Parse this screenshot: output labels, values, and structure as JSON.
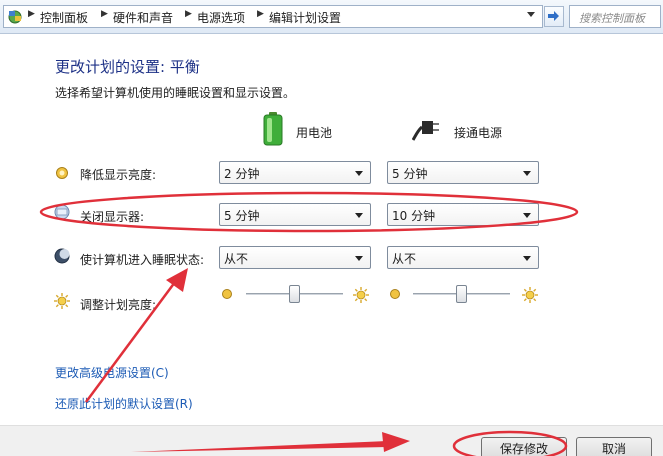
{
  "breadcrumbs": [
    "控制面板",
    "硬件和声音",
    "电源选项",
    "编辑计划设置"
  ],
  "search": {
    "placeholder": "搜索控制面板"
  },
  "page": {
    "title": "更改计划的设置: 平衡",
    "subtitle": "选择希望计算机使用的睡眠设置和显示设置。"
  },
  "columns": {
    "battery": "用电池",
    "plugged": "接通电源"
  },
  "settings": {
    "dim_display": {
      "label": "降低显示亮度:",
      "battery": "2 分钟",
      "plugged": "5 分钟"
    },
    "turn_off_display": {
      "label": "关闭显示器:",
      "battery": "5 分钟",
      "plugged": "10 分钟"
    },
    "sleep": {
      "label": "使计算机进入睡眠状态:",
      "battery": "从不",
      "plugged": "从不"
    },
    "brightness": {
      "label": "调整计划亮度:",
      "battery_level_percent": 50,
      "plugged_level_percent": 50
    }
  },
  "links": {
    "advanced": "更改高级电源设置(C)",
    "restore": "还原此计划的默认设置(R)"
  },
  "buttons": {
    "save": "保存修改",
    "cancel": "取消"
  },
  "colors": {
    "accent": "#1e3287",
    "link": "#1c5bb5",
    "annotation": "#e0303a"
  }
}
